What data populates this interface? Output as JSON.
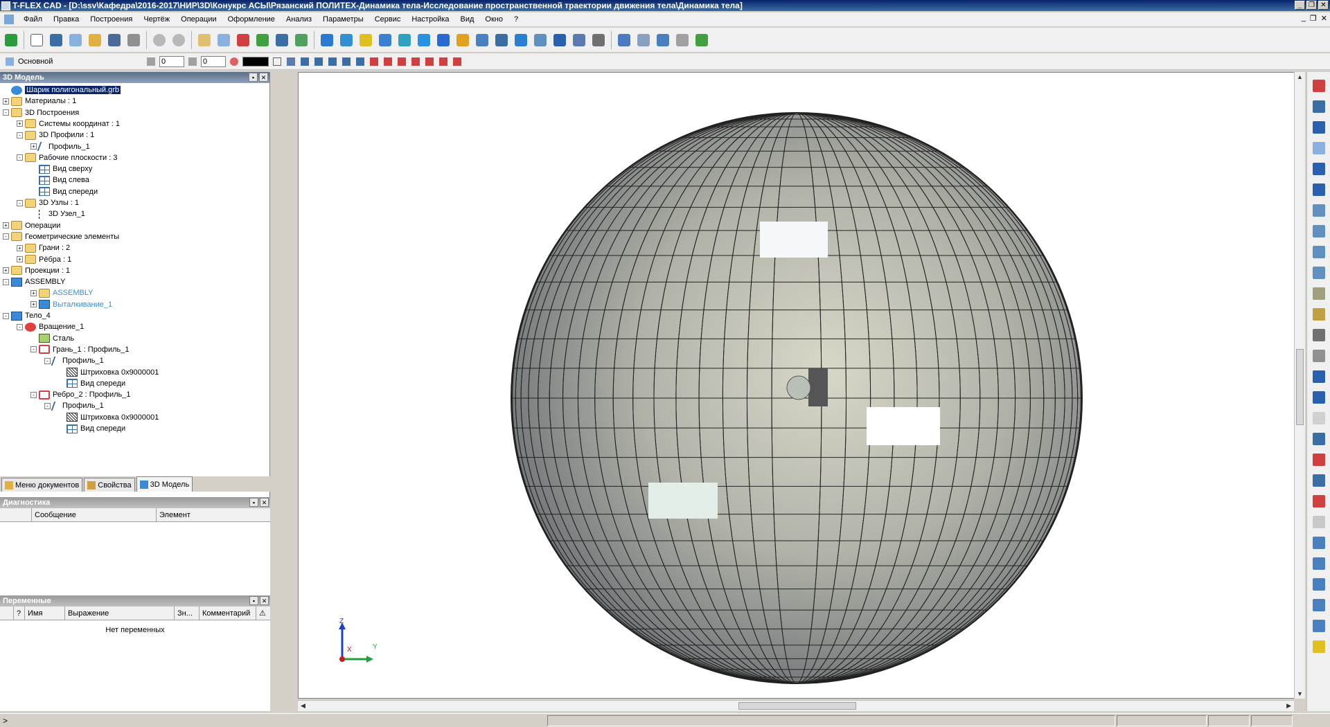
{
  "window": {
    "title": "T-FLEX CAD - [D:\\ssv\\Кафедра\\2016-2017\\НИР\\3D\\Конукрс АСЫ\\Рязанский ПОЛИТЕХ-Динамика тела-Исследование пространственной траектории движения тела\\Динамика тела]"
  },
  "menu": {
    "items": [
      "Файл",
      "Правка",
      "Построения",
      "Чертёж",
      "Операции",
      "Оформление",
      "Анализ",
      "Параметры",
      "Сервис",
      "Настройка",
      "Вид",
      "Окно",
      "?"
    ]
  },
  "toolbar2": {
    "style_label": "Основной",
    "field1": "0",
    "field2": "0",
    "color": "#000000"
  },
  "model_panel": {
    "title": "3D Модель",
    "tree": [
      {
        "label": "Шарик полигональный.grb",
        "level": 0,
        "icon": "root-icon",
        "expand": "",
        "selected": true
      },
      {
        "label": "Материалы : 1",
        "level": 0,
        "icon": "folder-icon",
        "expand": "+"
      },
      {
        "label": "3D Построения",
        "level": 0,
        "icon": "folder-icon",
        "expand": "-"
      },
      {
        "label": "Системы координат : 1",
        "level": 1,
        "icon": "folder-icon",
        "expand": "+"
      },
      {
        "label": "3D Профили : 1",
        "level": 1,
        "icon": "folder-icon",
        "expand": "-"
      },
      {
        "label": "Профиль_1",
        "level": 2,
        "icon": "profile-icon",
        "expand": "+"
      },
      {
        "label": "Рабочие плоскости : 3",
        "level": 1,
        "icon": "folder-icon",
        "expand": "-"
      },
      {
        "label": "Вид сверху",
        "level": 2,
        "icon": "plane-icon",
        "expand": ""
      },
      {
        "label": "Вид слева",
        "level": 2,
        "icon": "plane-icon",
        "expand": ""
      },
      {
        "label": "Вид спереди",
        "level": 2,
        "icon": "plane-icon",
        "expand": ""
      },
      {
        "label": "3D Узлы : 1",
        "level": 1,
        "icon": "folder-icon",
        "expand": "-"
      },
      {
        "label": "3D Узел_1",
        "level": 2,
        "icon": "node-icon",
        "expand": ""
      },
      {
        "label": "Операции",
        "level": 0,
        "icon": "folder-icon",
        "expand": "+"
      },
      {
        "label": "Геометрические элементы",
        "level": 0,
        "icon": "folder-icon",
        "expand": "-"
      },
      {
        "label": "Грани : 2",
        "level": 1,
        "icon": "folder-icon",
        "expand": "+"
      },
      {
        "label": "Рёбра : 1",
        "level": 1,
        "icon": "folder-icon",
        "expand": "+"
      },
      {
        "label": "Проекции : 1",
        "level": 0,
        "icon": "folder-icon",
        "expand": "+"
      },
      {
        "label": "ASSEMBLY",
        "level": 0,
        "icon": "body-icon",
        "expand": "-"
      },
      {
        "label": "ASSEMBLY",
        "level": 2,
        "icon": "folder-icon",
        "expand": "+",
        "blue": true
      },
      {
        "label": "Выталкивание_1",
        "level": 2,
        "icon": "body-icon",
        "expand": "+",
        "blue": true
      },
      {
        "label": "Тело_4",
        "level": 0,
        "icon": "body-icon",
        "expand": "-"
      },
      {
        "label": "Вращение_1",
        "level": 1,
        "icon": "rotation-icon",
        "expand": "-"
      },
      {
        "label": "Сталь",
        "level": 2,
        "icon": "steel-icon",
        "expand": ""
      },
      {
        "label": "Грань_1 : Профиль_1",
        "level": 2,
        "icon": "face-icon",
        "expand": "-"
      },
      {
        "label": "Профиль_1",
        "level": 3,
        "icon": "profile-icon",
        "expand": "-"
      },
      {
        "label": "Штриховка 0x9000001",
        "level": 4,
        "icon": "hatch-icon",
        "expand": ""
      },
      {
        "label": "Вид спереди",
        "level": 4,
        "icon": "plane-icon",
        "expand": ""
      },
      {
        "label": "Ребро_2 : Профиль_1",
        "level": 2,
        "icon": "face-icon",
        "expand": "-"
      },
      {
        "label": "Профиль_1",
        "level": 3,
        "icon": "profile-icon",
        "expand": "-"
      },
      {
        "label": "Штриховка 0x9000001",
        "level": 4,
        "icon": "hatch-icon",
        "expand": ""
      },
      {
        "label": "Вид спереди",
        "level": 4,
        "icon": "plane-icon",
        "expand": ""
      }
    ]
  },
  "tabs": {
    "docs": "Меню документов",
    "props": "Свойства",
    "model": "3D Модель"
  },
  "diagnostics": {
    "title": "Диагностика",
    "col_message": "Сообщение",
    "col_element": "Элемент"
  },
  "variables": {
    "title": "Переменные",
    "col_q": "?",
    "col_name": "Имя",
    "col_expr": "Выражение",
    "col_val": "Зн...",
    "col_comment": "Комментарий",
    "empty": "Нет переменных"
  },
  "axes": {
    "z": "Z",
    "y": "Y",
    "x": "X"
  },
  "status": {
    "prompt": ">"
  }
}
